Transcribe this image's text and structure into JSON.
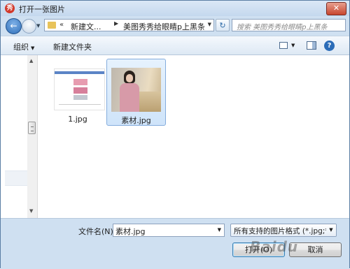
{
  "window": {
    "title": "打开一张图片",
    "close_label": "✕",
    "app_icon_glyph": "秀"
  },
  "nav": {
    "back_glyph": "←",
    "crumb_arrows": "«",
    "crumb1": "新建文...",
    "crumb_sep": "▶",
    "crumb2": "美图秀秀给眼睛p上黑条",
    "refresh_glyph": "↻",
    "search_placeholder": "搜索 美图秀秀给眼睛p上黑条"
  },
  "toolbar": {
    "organize_label": "组织",
    "new_folder_label": "新建文件夹",
    "help_glyph": "?"
  },
  "files": [
    {
      "name": "1.jpg",
      "selected": false
    },
    {
      "name": "素材.jpg",
      "selected": true
    }
  ],
  "bottom": {
    "filename_label": "文件名(N):",
    "filename_value": "素材.jpg",
    "filter_value": "所有支持的图片格式 (*.jpg;*.jp",
    "open_label": "打开(O)",
    "cancel_label": "取消",
    "watermark": "Baidu"
  },
  "icons": [
    "app-icon",
    "close-icon",
    "back-icon",
    "forward-icon",
    "folder-icon",
    "refresh-icon",
    "search-icon",
    "view-icon",
    "preview-pane-icon",
    "help-icon"
  ],
  "colors": {
    "title_bg": "#c4d8ee",
    "selection_bg": "#cfe4fa",
    "selection_border": "#84acdd",
    "close_red": "#c7452e"
  }
}
